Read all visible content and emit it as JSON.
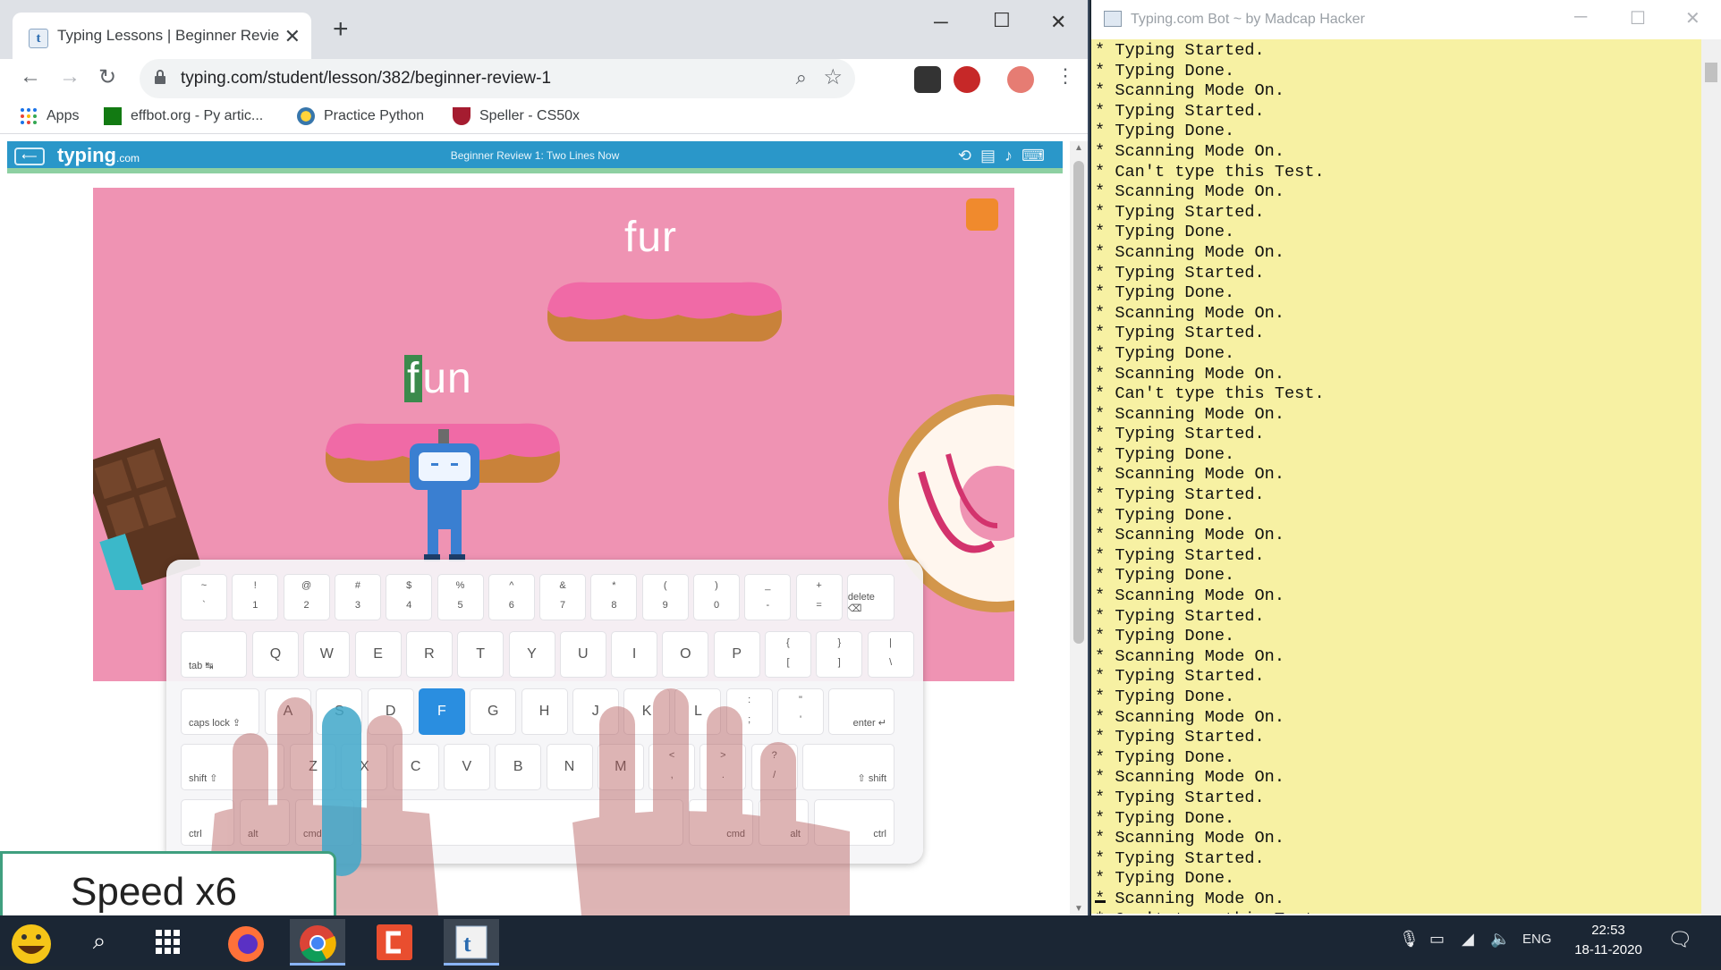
{
  "browser": {
    "tab_title": "Typing Lessons | Beginner Revie…",
    "url": "typing.com/student/lesson/382/beginner-review-1",
    "bookmarks": [
      {
        "label": "Apps"
      },
      {
        "label": "effbot.org - Py artic..."
      },
      {
        "label": "Practice Python"
      },
      {
        "label": "Speller - CS50x"
      }
    ]
  },
  "site": {
    "logo": "typing",
    "logo_suffix": ".com",
    "lesson_title": "Beginner Review 1: Two Lines Now"
  },
  "game": {
    "word_top": "fur",
    "word_active_typed": "f",
    "word_active_rest": "un"
  },
  "keyboard": {
    "row1": [
      {
        "top": "~",
        "bottom": "`"
      },
      {
        "top": "!",
        "bottom": "1"
      },
      {
        "top": "@",
        "bottom": "2"
      },
      {
        "top": "#",
        "bottom": "3"
      },
      {
        "top": "$",
        "bottom": "4"
      },
      {
        "top": "%",
        "bottom": "5"
      },
      {
        "top": "^",
        "bottom": "6"
      },
      {
        "top": "&",
        "bottom": "7"
      },
      {
        "top": "*",
        "bottom": "8"
      },
      {
        "top": "(",
        "bottom": "9"
      },
      {
        "top": ")",
        "bottom": "0"
      },
      {
        "top": "_",
        "bottom": "-"
      },
      {
        "top": "+",
        "bottom": "="
      }
    ],
    "delete_label": "delete ⌫",
    "tab_label": "tab ↹",
    "row2": [
      "Q",
      "W",
      "E",
      "R",
      "T",
      "Y",
      "U",
      "I",
      "O",
      "P"
    ],
    "row2_sym": [
      {
        "top": "{",
        "bottom": "["
      },
      {
        "top": "}",
        "bottom": "]"
      },
      {
        "top": "|",
        "bottom": "\\"
      }
    ],
    "caps_label": "caps lock ⇪",
    "row3": [
      "A",
      "S",
      "D",
      "F",
      "G",
      "H",
      "J",
      "K",
      "L"
    ],
    "row3_sym": [
      {
        "top": ":",
        "bottom": ";"
      },
      {
        "top": "\"",
        "bottom": "'"
      }
    ],
    "enter_label": "enter ↵",
    "shift_left_label": "shift ⇧",
    "row4": [
      "Z",
      "X",
      "C",
      "V",
      "B",
      "N",
      "M"
    ],
    "row4_sym": [
      {
        "top": "<",
        "bottom": ","
      },
      {
        "top": ">",
        "bottom": "."
      },
      {
        "top": "?",
        "bottom": "/"
      }
    ],
    "shift_right_label": "⇧ shift",
    "ctrl_label": "ctrl",
    "alt_label": "alt",
    "cmd_label": "cmd",
    "highlighted_key": "F"
  },
  "overlay": {
    "speed_label": "Speed x6"
  },
  "console": {
    "title": "Typing.com Bot ~ by Madcap Hacker",
    "lines": [
      "* Typing Started.",
      "* Typing Done.",
      "* Scanning Mode On.",
      "* Typing Started.",
      "* Typing Done.",
      "* Scanning Mode On.",
      "* Can't type this Test.",
      "* Scanning Mode On.",
      "* Typing Started.",
      "* Typing Done.",
      "* Scanning Mode On.",
      "* Typing Started.",
      "* Typing Done.",
      "* Scanning Mode On.",
      "* Typing Started.",
      "* Typing Done.",
      "* Scanning Mode On.",
      "* Can't type this Test.",
      "* Scanning Mode On.",
      "* Typing Started.",
      "* Typing Done.",
      "* Scanning Mode On.",
      "* Typing Started.",
      "* Typing Done.",
      "* Scanning Mode On.",
      "* Typing Started.",
      "* Typing Done.",
      "* Scanning Mode On.",
      "* Typing Started.",
      "* Typing Done.",
      "* Scanning Mode On.",
      "* Typing Started.",
      "* Typing Done.",
      "* Scanning Mode On.",
      "* Typing Started.",
      "* Typing Done.",
      "* Scanning Mode On.",
      "* Typing Started.",
      "* Typing Done.",
      "* Scanning Mode On.",
      "* Typing Started.",
      "* Typing Done.",
      "* Scanning Mode On.",
      "* Can't type this Test.",
      "* Scanning Mode On."
    ]
  },
  "taskbar": {
    "language": "ENG",
    "time": "22:53",
    "date": "18-11-2020"
  },
  "colors": {
    "game_bg": "#ef93b3",
    "console_bg": "#f7f1a3",
    "site_header": "#2a97c9",
    "key_highlight": "#2a8ee0"
  }
}
